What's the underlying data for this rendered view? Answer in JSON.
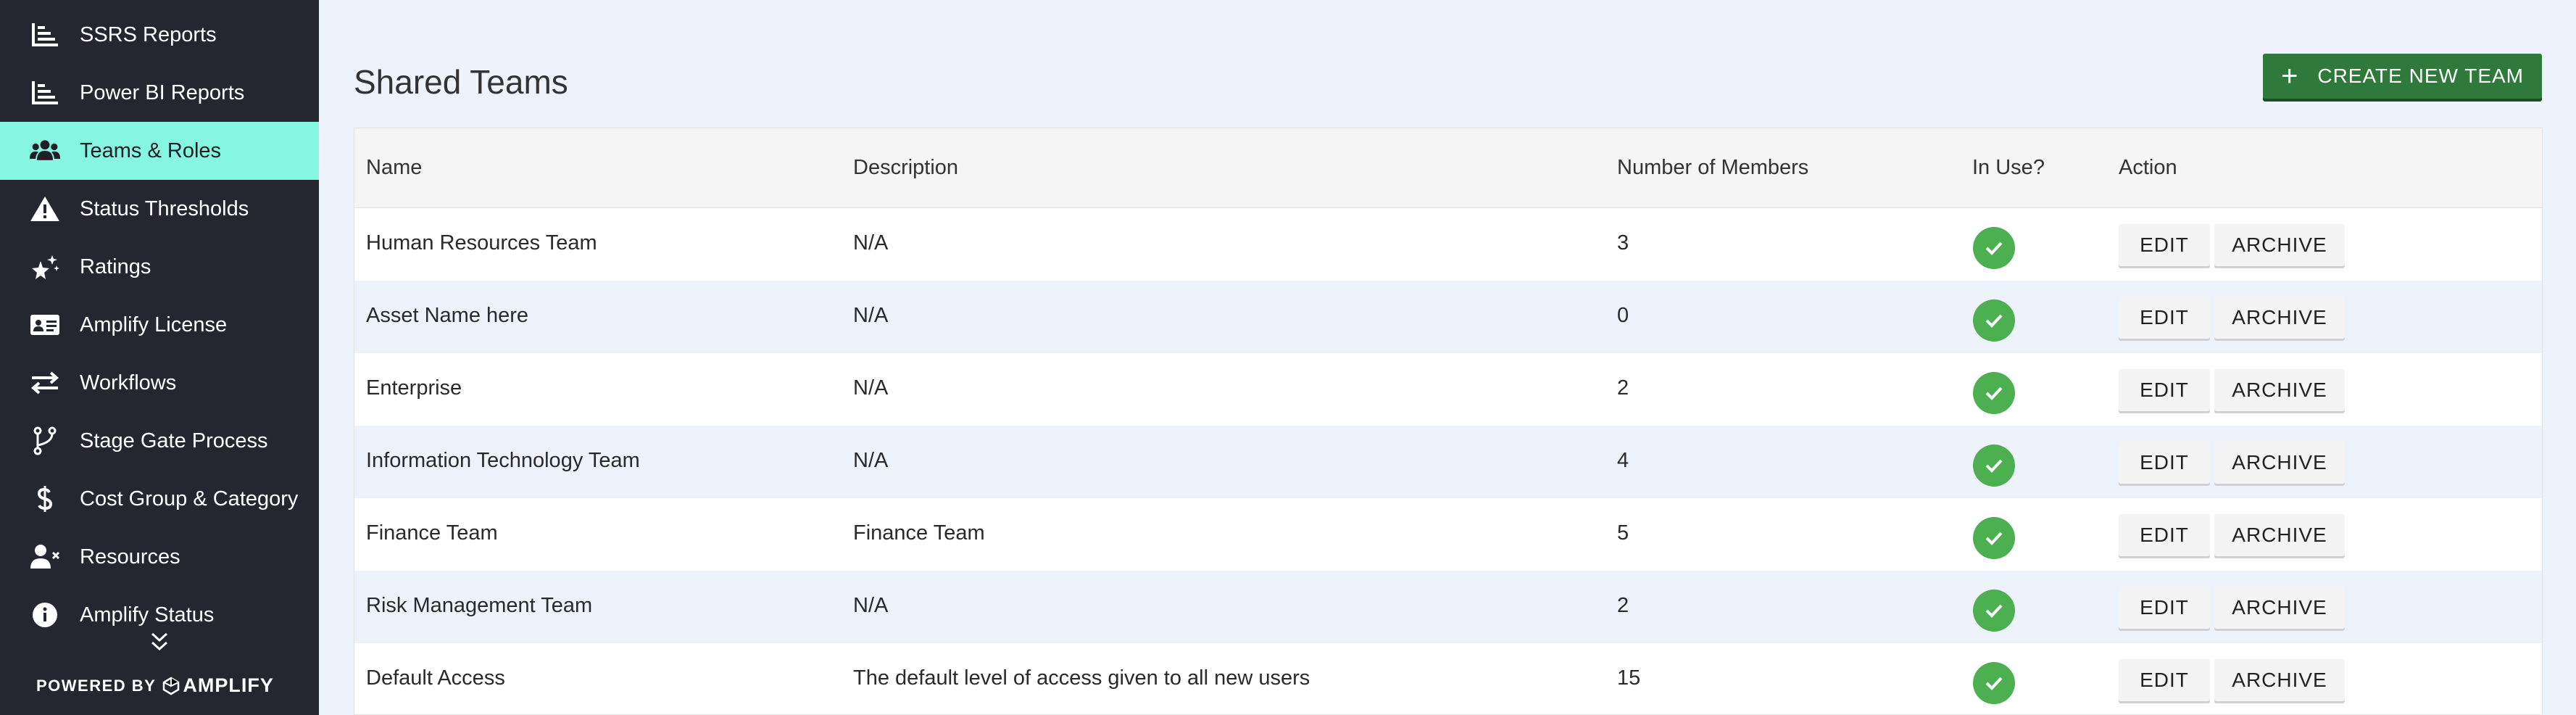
{
  "sidebar": {
    "items": [
      {
        "label": "SSRS Reports",
        "icon": "bar-chart-icon",
        "active": false
      },
      {
        "label": "Power BI Reports",
        "icon": "bar-chart-icon",
        "active": false
      },
      {
        "label": "Teams & Roles",
        "icon": "users-icon",
        "active": true
      },
      {
        "label": "Status Thresholds",
        "icon": "warning-icon",
        "active": false
      },
      {
        "label": "Ratings",
        "icon": "sparkle-star-icon",
        "active": false
      },
      {
        "label": "Amplify License",
        "icon": "id-card-icon",
        "active": false
      },
      {
        "label": "Workflows",
        "icon": "swap-arrows-icon",
        "active": false
      },
      {
        "label": "Stage Gate Process",
        "icon": "branch-icon",
        "active": false
      },
      {
        "label": "Cost Group & Category",
        "icon": "dollar-icon",
        "active": false
      },
      {
        "label": "Resources",
        "icon": "user-remove-icon",
        "active": false
      },
      {
        "label": "Amplify Status",
        "icon": "info-icon",
        "active": false
      }
    ],
    "powered_by": "POWERED BY",
    "brand": "AMPLIFY",
    "active_color": "#86f5e1",
    "background_color": "#24272f"
  },
  "main": {
    "title": "Shared Teams",
    "create_button": {
      "label": "CREATE NEW TEAM",
      "color": "#2f7a3b"
    },
    "table": {
      "headers": {
        "name": "Name",
        "description": "Description",
        "members": "Number of Members",
        "in_use": "In Use?",
        "action": "Action"
      },
      "rows": [
        {
          "name": "Human Resources Team",
          "description": "N/A",
          "members": "3",
          "in_use": true,
          "edit": "EDIT",
          "archive": "ARCHIVE"
        },
        {
          "name": "Asset Name here",
          "description": "N/A",
          "members": "0",
          "in_use": true,
          "edit": "EDIT",
          "archive": "ARCHIVE"
        },
        {
          "name": "Enterprise",
          "description": "N/A",
          "members": "2",
          "in_use": true,
          "edit": "EDIT",
          "archive": "ARCHIVE"
        },
        {
          "name": "Information Technology Team",
          "description": "N/A",
          "members": "4",
          "in_use": true,
          "edit": "EDIT",
          "archive": "ARCHIVE"
        },
        {
          "name": "Finance Team",
          "description": "Finance Team",
          "members": "5",
          "in_use": true,
          "edit": "EDIT",
          "archive": "ARCHIVE"
        },
        {
          "name": "Risk Management Team",
          "description": "N/A",
          "members": "2",
          "in_use": true,
          "edit": "EDIT",
          "archive": "ARCHIVE"
        },
        {
          "name": "Default Access",
          "description": "The default level of access given to all new users",
          "members": "15",
          "in_use": true,
          "edit": "EDIT",
          "archive": "ARCHIVE"
        }
      ],
      "in_use_color": "#4caf50"
    }
  }
}
